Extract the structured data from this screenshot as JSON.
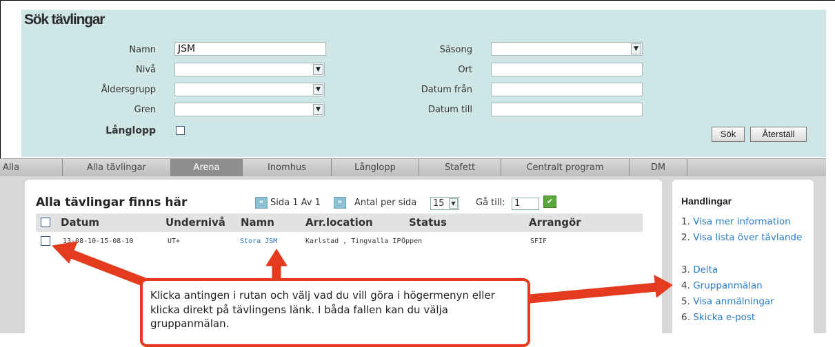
{
  "search": {
    "title": "Sök tävlingar",
    "fields": {
      "name_label": "Namn",
      "name_value": "JSM",
      "level_label": "Nivå",
      "age_group_label": "Åldersgrupp",
      "event_label": "Gren",
      "long_distance_label": "Långlopp",
      "season_label": "Säsong",
      "city_label": "Ort",
      "date_from_label": "Datum från",
      "date_to_label": "Datum till"
    },
    "search_button": "Sök",
    "reset_button": "Återställ"
  },
  "tabs": [
    {
      "label": "Alla"
    },
    {
      "label": "Alla tävlingar"
    },
    {
      "label": "Arena",
      "active": true
    },
    {
      "label": "Inomhus"
    },
    {
      "label": "Långlopp"
    },
    {
      "label": "Stafett"
    },
    {
      "label": "Centralt program"
    },
    {
      "label": "DM"
    }
  ],
  "list": {
    "title": "Alla tävlingar finns här",
    "pager": {
      "page_text": "Sida 1 Av 1",
      "per_page_label": "Antal per sida",
      "per_page_value": "15",
      "goto_label": "Gå till:",
      "goto_value": "1"
    },
    "columns": [
      "Datum",
      "Undernivå",
      "Namn",
      "Arr.location",
      "Status",
      "Arrangör"
    ],
    "rows": [
      {
        "datum": "13-08-10-15-08-10",
        "undernivå": "UT+",
        "namn": "Stora JSM",
        "location": "Karlstad , Tingvalla IP",
        "status": "Öppen",
        "arrangör": "SFIF"
      }
    ]
  },
  "sidebar": {
    "title": "Handlingar",
    "items": [
      {
        "num": "1.",
        "label": "Visa mer information"
      },
      {
        "num": "2.",
        "label": "Visa lista över tävlande"
      },
      {
        "num": "3.",
        "label": "Delta"
      },
      {
        "num": "4.",
        "label": "Gruppanmälan"
      },
      {
        "num": "5.",
        "label": "Visa anmälningar"
      },
      {
        "num": "6.",
        "label": "Skicka e-post"
      }
    ]
  },
  "callout": {
    "text": "Klicka antingen i rutan och välj vad du vill göra i högermenyn eller klicka direkt på tävlingens länk. I båda fallen kan du välja gruppanmälan."
  },
  "colors": {
    "panel_bg": "#cfe6e6",
    "link": "#2a7bc6",
    "annotation": "#e43a1e",
    "active_tab": "#8f8f8f"
  }
}
